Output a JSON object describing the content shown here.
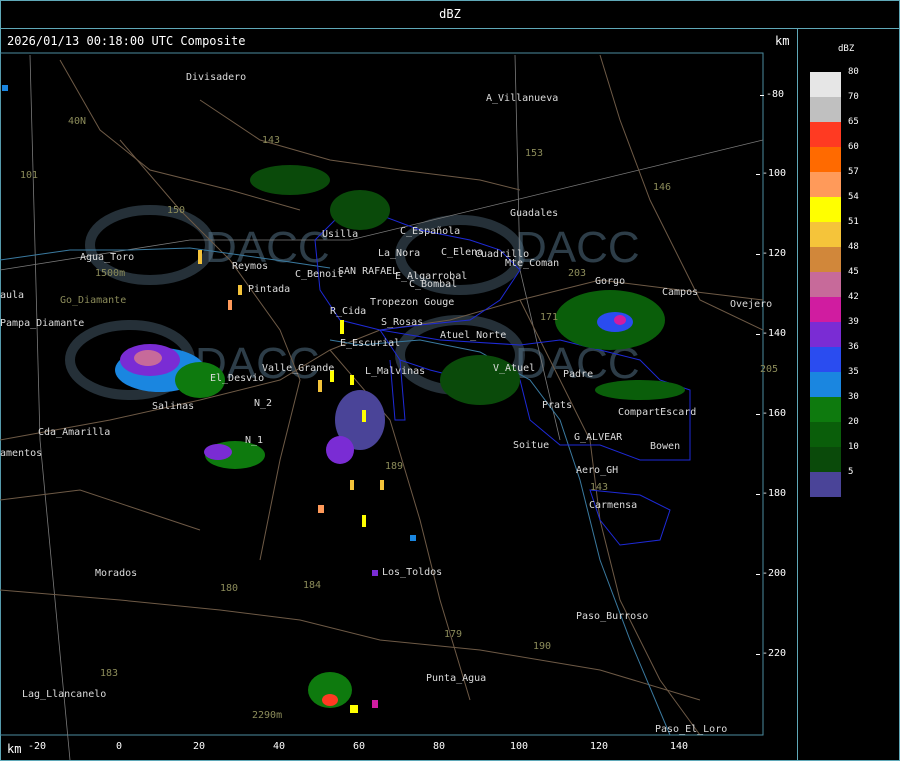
{
  "title": "dBZ",
  "header": {
    "timestamp": "2026/01/13 00:18:00 UTC Composite",
    "unit_right": "km",
    "unit_left": "km"
  },
  "legend": {
    "unit": "dBZ",
    "entries": [
      {
        "label": "80",
        "color": "#e6e6e6"
      },
      {
        "label": "70",
        "color": "#c0c0c0"
      },
      {
        "label": "65",
        "color": "#ff3a22"
      },
      {
        "label": "60",
        "color": "#ff6a00"
      },
      {
        "label": "57",
        "color": "#ff9a5a"
      },
      {
        "label": "54",
        "color": "#ffff00"
      },
      {
        "label": "51",
        "color": "#f5c43a"
      },
      {
        "label": "48",
        "color": "#d1873a"
      },
      {
        "label": "45",
        "color": "#c76a9a"
      },
      {
        "label": "42",
        "color": "#d01ca0"
      },
      {
        "label": "39",
        "color": "#7a2cd4"
      },
      {
        "label": "36",
        "color": "#2a4cf0"
      },
      {
        "label": "35",
        "color": "#1a86e0"
      },
      {
        "label": "30",
        "color": "#0e7a0e"
      },
      {
        "label": "20",
        "color": "#0a5e0a"
      },
      {
        "label": "10",
        "color": "#0a4a0a"
      },
      {
        "label": "5",
        "color": "#4a4498"
      }
    ]
  },
  "axes": {
    "x_ticks": [
      "-20",
      "0",
      "20",
      "40",
      "60",
      "80",
      "100",
      "120",
      "140"
    ],
    "y_ticks": [
      "-80",
      "-100",
      "-120",
      "-140",
      "-160",
      "-180",
      "-200",
      "-220"
    ]
  },
  "places": [
    "Divisadero",
    "A_Villanueva",
    "40N",
    "101",
    "150",
    "143",
    "153",
    "146",
    "Guadales",
    "Agua_Toro",
    "1500m",
    "Go_Diamante",
    "Pampa_Diamante",
    "aula",
    "Usilla",
    "C_Española",
    "La_Nora",
    "C_Elena",
    "Cuadrillo",
    "Mte_Coman",
    "C_Benoit",
    "SAN RAFAEL",
    "E_Algarrobal",
    "C_Bombal",
    "Reymos",
    "Pintada",
    "Tropezon Gouge",
    "R_Cida",
    "S_Rosas",
    "Atuel_Norte",
    "E_Escurial",
    "Valle_Grande",
    "L_Malvinas",
    "V_Atuel",
    "Padre",
    "El_Desvio",
    "Salinas",
    "N_2",
    "Cda_Amarilla",
    "amentos",
    "N_1",
    "Soitue",
    "Prats",
    "G_ALVEAR",
    "CompartEscard",
    "Bowen",
    "Aero_GH",
    "Carmensa",
    "Gorgo",
    "Campos",
    "Ovejero",
    "203",
    "171",
    "205",
    "143",
    "Morados",
    "180",
    "184",
    "189",
    "179",
    "190",
    "Los_Toldos",
    "Paso_Burroso",
    "Punta_Agua",
    "183",
    "Lag_Llancanelo",
    "2290m",
    "Paso_El_Loro"
  ],
  "watermark": "DACC",
  "map_colors": {
    "background": "#000000",
    "roads": "#6e5a46",
    "rivers": "#3a7aa0",
    "boundaries": "#1e2ad8",
    "grid": "#7a7a7a"
  }
}
